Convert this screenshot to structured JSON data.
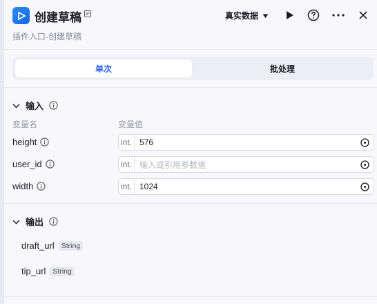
{
  "header": {
    "title": "创建草稿",
    "subtitle": "插件入口-创建草稿",
    "mode_label": "真实数据"
  },
  "tabs": [
    {
      "label": "单次",
      "active": true
    },
    {
      "label": "批处理",
      "active": false
    }
  ],
  "input": {
    "section_title": "输入",
    "col_name": "变量名",
    "col_value": "变量值",
    "rows": [
      {
        "name": "height",
        "type": "int.",
        "value": "576"
      },
      {
        "name": "user_id",
        "type": "int.",
        "placeholder": "输入或引用参数值"
      },
      {
        "name": "width",
        "type": "int.",
        "value": "1024"
      }
    ]
  },
  "output": {
    "section_title": "输出",
    "rows": [
      {
        "name": "draft_url",
        "type": "String"
      },
      {
        "name": "tip_url",
        "type": "String"
      }
    ]
  },
  "colors": {
    "accent": "#2c62f6",
    "logo": "#1766e8"
  }
}
